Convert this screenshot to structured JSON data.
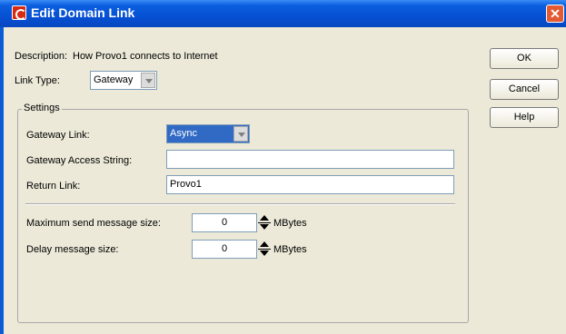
{
  "window": {
    "title": "Edit Domain Link",
    "close_symbol": "✕",
    "icon": "app-logo-icon"
  },
  "form": {
    "description_label": "Description:",
    "description_value": "How Provo1 connects to Internet",
    "link_type_label": "Link Type:",
    "link_type_value": "Gateway"
  },
  "settings": {
    "group_title": "Settings",
    "gateway_link_label": "Gateway Link:",
    "gateway_link_value": "Async",
    "gateway_access_string_label": "Gateway Access String:",
    "gateway_access_string_value": "",
    "return_link_label": "Return Link:",
    "return_link_value": "Provo1",
    "max_send_label": "Maximum send message size:",
    "max_send_value": "0",
    "max_send_unit": "MBytes",
    "delay_label": "Delay message size:",
    "delay_value": "0",
    "delay_unit": "MBytes"
  },
  "buttons": {
    "ok": "OK",
    "cancel": "Cancel",
    "help": "Help"
  },
  "colors": {
    "titlebar": "#0650d4",
    "selection": "#316ac5",
    "dialog_bg": "#ece9d8"
  }
}
